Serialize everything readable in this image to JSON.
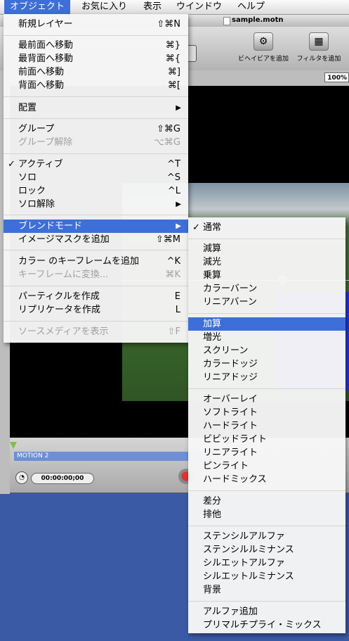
{
  "window": {
    "title": "sample.motn",
    "toolbar": {
      "behaviors_label": "ビヘイビアを追加",
      "filters_label": "フィルタを追加"
    },
    "zoom": "100%",
    "timeline": {
      "track_label": "MOTION 2",
      "timecode": "00:00:00;00"
    }
  },
  "menubar": {
    "items": [
      "オブジェクト",
      "お気に入り",
      "表示",
      "ウインドウ",
      "ヘルプ"
    ]
  },
  "object_menu": {
    "items": [
      {
        "label": "新規レイヤー",
        "shortcut": "⇧⌘N"
      },
      {
        "label": "最前面へ移動",
        "shortcut": "⌘}"
      },
      {
        "label": "最背面へ移動",
        "shortcut": "⌘{"
      },
      {
        "label": "前面へ移動",
        "shortcut": "⌘]"
      },
      {
        "label": "背面へ移動",
        "shortcut": "⌘["
      },
      {
        "label": "配置",
        "shortcut": "▶"
      },
      {
        "label": "グループ",
        "shortcut": "⇧⌘G"
      },
      {
        "label": "グループ解除",
        "shortcut": "⌥⌘G"
      },
      {
        "label": "アクティブ",
        "shortcut": "^T"
      },
      {
        "label": "ソロ",
        "shortcut": "^S"
      },
      {
        "label": "ロック",
        "shortcut": "^L"
      },
      {
        "label": "ソロ解除",
        "shortcut": "▶"
      },
      {
        "label": "ブレンドモード",
        "shortcut": "▶"
      },
      {
        "label": "イメージマスクを追加",
        "shortcut": "⇧⌘M"
      },
      {
        "label": "カラー のキーフレームを追加",
        "shortcut": "^K"
      },
      {
        "label": "キーフレームに変換...",
        "shortcut": "⌘K"
      },
      {
        "label": "パーティクルを作成",
        "shortcut": "E"
      },
      {
        "label": "リプリケータを作成",
        "shortcut": "L"
      },
      {
        "label": "ソースメディアを表示",
        "shortcut": "⇧F"
      }
    ]
  },
  "blend_menu": {
    "items": [
      "通常",
      "減算",
      "減光",
      "乗算",
      "カラーバーン",
      "リニアバーン",
      "加算",
      "増光",
      "スクリーン",
      "カラードッジ",
      "リニアドッジ",
      "オーバーレイ",
      "ソフトライト",
      "ハードライト",
      "ビビッドライト",
      "リニアライト",
      "ピンライト",
      "ハードミックス",
      "差分",
      "排他",
      "ステンシルアルファ",
      "ステンシルルミナンス",
      "シルエットアルファ",
      "シルエットルミナンス",
      "背景",
      "アルファ追加",
      "プリマルチプライ・ミックス"
    ]
  },
  "checkmark": "✓",
  "colors": {
    "highlight": "#3e6fd8",
    "desktop": "#3b5aa6"
  }
}
